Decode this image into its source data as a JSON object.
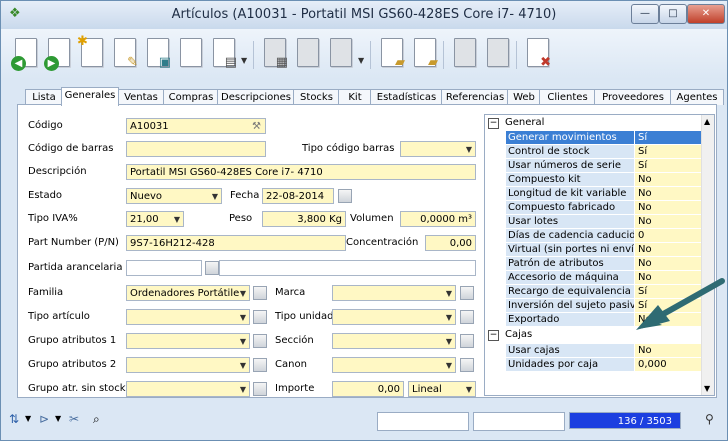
{
  "window": {
    "title": "Artículos (A10031 - Portatil MSI GS60-428ES Core i7- 4710)",
    "app_icon": "app-icon",
    "controls": [
      "minimize",
      "maximize",
      "close"
    ]
  },
  "toolbar": {
    "buttons": [
      "first-record",
      "previous-record",
      "new",
      "edit",
      "delete",
      "copy",
      "print",
      "save",
      "cancel",
      "refresh",
      "documents-in",
      "documents-out",
      "report",
      "exit"
    ]
  },
  "tabs": [
    "Lista",
    "Generales",
    "Ventas",
    "Compras",
    "Descripciones",
    "Stocks",
    "Kit",
    "Estadísticas",
    "Referencias",
    "Web",
    "Clientes",
    "Proveedores",
    "Agentes"
  ],
  "active_tab": "Generales",
  "form": {
    "codigo": {
      "label": "Código",
      "value": "A10031"
    },
    "codigo_barras": {
      "label": "Código de barras",
      "value": ""
    },
    "tipo_codigo_barras": {
      "label": "Tipo código barras",
      "value": ""
    },
    "descripcion": {
      "label": "Descripción",
      "value": "Portatil MSI GS60-428ES Core i7- 4710"
    },
    "estado": {
      "label": "Estado",
      "value": "Nuevo"
    },
    "fecha": {
      "label": "Fecha",
      "value": "22-08-2014"
    },
    "tipo_iva": {
      "label": "Tipo IVA%",
      "value": "21,00"
    },
    "peso": {
      "label": "Peso",
      "value": "3,800 Kg"
    },
    "volumen": {
      "label": "Volumen",
      "value": "0,0000 m³"
    },
    "part_number": {
      "label": "Part Number (P/N)",
      "value": "9S7-16H212-428"
    },
    "concentracion": {
      "label": "Concentración",
      "value": "0,00"
    },
    "partida_arancelaria": {
      "label": "Partida arancelaria",
      "value": ""
    },
    "familia": {
      "label": "Familia",
      "value": "Ordenadores Portátile"
    },
    "marca": {
      "label": "Marca",
      "value": ""
    },
    "tipo_articulo": {
      "label": "Tipo artículo",
      "value": ""
    },
    "tipo_unidad": {
      "label": "Tipo unidad",
      "value": ""
    },
    "grupo_atributos_1": {
      "label": "Grupo atributos 1",
      "value": ""
    },
    "seccion": {
      "label": "Sección",
      "value": ""
    },
    "grupo_atributos_2": {
      "label": "Grupo atributos 2",
      "value": ""
    },
    "canon": {
      "label": "Canon",
      "value": ""
    },
    "grupo_atr_sin_stock": {
      "label": "Grupo atr. sin stock",
      "value": ""
    },
    "importe": {
      "label": "Importe",
      "value": "0,00",
      "mode": "Lineal"
    }
  },
  "properties": {
    "group_general": "General",
    "rows": [
      {
        "name": "Generar movimientos",
        "value": "Sí"
      },
      {
        "name": "Control de stock",
        "value": "Sí"
      },
      {
        "name": "Usar números de serie",
        "value": "Sí"
      },
      {
        "name": "Compuesto kit",
        "value": "No"
      },
      {
        "name": "Longitud de kit variable",
        "value": "No"
      },
      {
        "name": "Compuesto fabricado",
        "value": "No"
      },
      {
        "name": "Usar lotes",
        "value": "No"
      },
      {
        "name": "Días de cadencia caducidad",
        "value": "0"
      },
      {
        "name": "Virtual (sin portes ni envío)",
        "value": "No"
      },
      {
        "name": "Patrón de atributos",
        "value": "No"
      },
      {
        "name": "Accesorio de máquina",
        "value": "No"
      },
      {
        "name": "Recargo de equivalencia",
        "value": "Sí"
      },
      {
        "name": "Inversión del sujeto pasivo",
        "value": "Sí"
      },
      {
        "name": "Exportado",
        "value": "No"
      }
    ],
    "group_cajas": "Cajas",
    "rows_cajas": [
      {
        "name": "Usar cajas",
        "value": "No"
      },
      {
        "name": "Unidades por caja",
        "value": "0,000"
      }
    ]
  },
  "status": {
    "record_position": "136 / 3503"
  },
  "colors": {
    "field_yellow": "#fff8c4",
    "selection": "#3b7fd4",
    "arrow": "#2f6b73"
  }
}
